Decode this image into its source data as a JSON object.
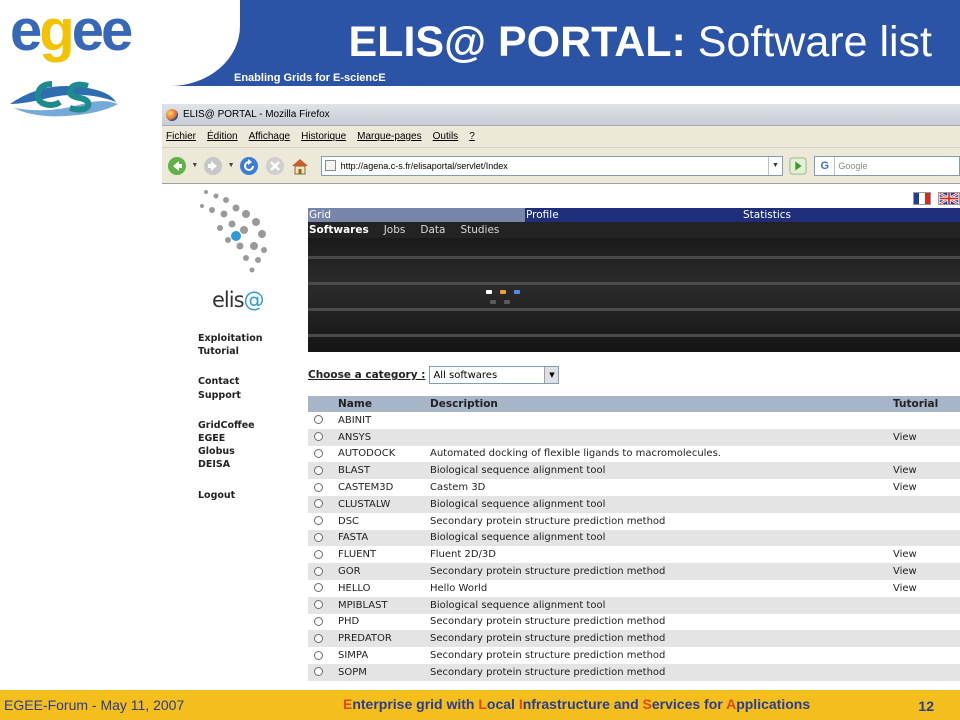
{
  "slide": {
    "title_bold": "ELIS@ PORTAL:",
    "title_rest": " Software list",
    "logo_text_e1": "e",
    "logo_text_g": "g",
    "logo_text_ee": "ee",
    "tagline": "Enabling Grids for E-sciencE"
  },
  "browser": {
    "window_title": "ELIS@ PORTAL - Mozilla Firefox",
    "menu": [
      "Fichier",
      "Édition",
      "Affichage",
      "Historique",
      "Marque-pages",
      "Outils",
      "?"
    ],
    "url": "http://agena.c-s.fr/elisaportal/servlet/Index",
    "search_placeholder": "Google",
    "search_icon_text": "G"
  },
  "portal": {
    "logo_name": "elis",
    "logo_at": "@",
    "left_nav": [
      [
        "Exploitation",
        "Tutorial"
      ],
      [
        "Contact",
        "Support"
      ],
      [
        "GridCoffee",
        "EGEE",
        "Globus",
        "DEISA"
      ],
      [
        "Logout"
      ]
    ],
    "main_tabs": {
      "grid": "Grid",
      "profile": "Profile",
      "statistics": "Statistics"
    },
    "sub_tabs": {
      "softwares": "Softwares",
      "jobs": "Jobs",
      "data": "Data",
      "studies": "Studies"
    },
    "category": {
      "label": "Choose a category :",
      "selected": "All softwares"
    },
    "table": {
      "headers": {
        "name": "Name",
        "description": "Description",
        "tutorial": "Tutorial"
      },
      "rows": [
        [
          "ABINIT",
          "",
          ""
        ],
        [
          "ANSYS",
          "",
          "View"
        ],
        [
          "AUTODOCK",
          "Automated docking of flexible ligands to macromolecules.",
          ""
        ],
        [
          "BLAST",
          "Biological sequence alignment tool",
          "View"
        ],
        [
          "CASTEM3D",
          "Castem 3D",
          "View"
        ],
        [
          "CLUSTALW",
          "Biological sequence alignment tool",
          ""
        ],
        [
          "DSC",
          "Secondary protein structure prediction method",
          ""
        ],
        [
          "FASTA",
          "Biological sequence alignment tool",
          ""
        ],
        [
          "FLUENT",
          "Fluent 2D/3D",
          "View"
        ],
        [
          "GOR",
          "Secondary protein structure prediction method",
          "View"
        ],
        [
          "HELLO",
          "Hello World",
          "View"
        ],
        [
          "MPIBLAST",
          "Biological sequence alignment tool",
          ""
        ],
        [
          "PHD",
          "Secondary protein structure prediction method",
          ""
        ],
        [
          "PREDATOR",
          "Secondary protein structure prediction method",
          ""
        ],
        [
          "SIMPA",
          "Secondary protein structure prediction method",
          ""
        ],
        [
          "SOPM",
          "Secondary protein structure prediction method",
          ""
        ]
      ]
    }
  },
  "footer": {
    "left": "EGEE-Forum - May 11, 2007",
    "center_parts": [
      {
        "text": "E",
        "hl": true
      },
      {
        "text": "nterprise grid with ",
        "hl": false
      },
      {
        "text": "L",
        "hl": true
      },
      {
        "text": "ocal ",
        "hl": false
      },
      {
        "text": "I",
        "hl": true
      },
      {
        "text": "nfrastructure and ",
        "hl": false
      },
      {
        "text": "S",
        "hl": true
      },
      {
        "text": "ervices for ",
        "hl": false
      },
      {
        "text": "A",
        "hl": true
      },
      {
        "text": "pplications",
        "hl": false
      }
    ],
    "page_number": "12"
  },
  "colors": {
    "header_blue": "#2b53a6",
    "footer_yellow": "#f4bf1c",
    "footer_text": "#2b3d8f",
    "footer_highlight": "#e0471a",
    "tab_bar": "#1e2e7a",
    "table_header": "#a7b5c8"
  }
}
